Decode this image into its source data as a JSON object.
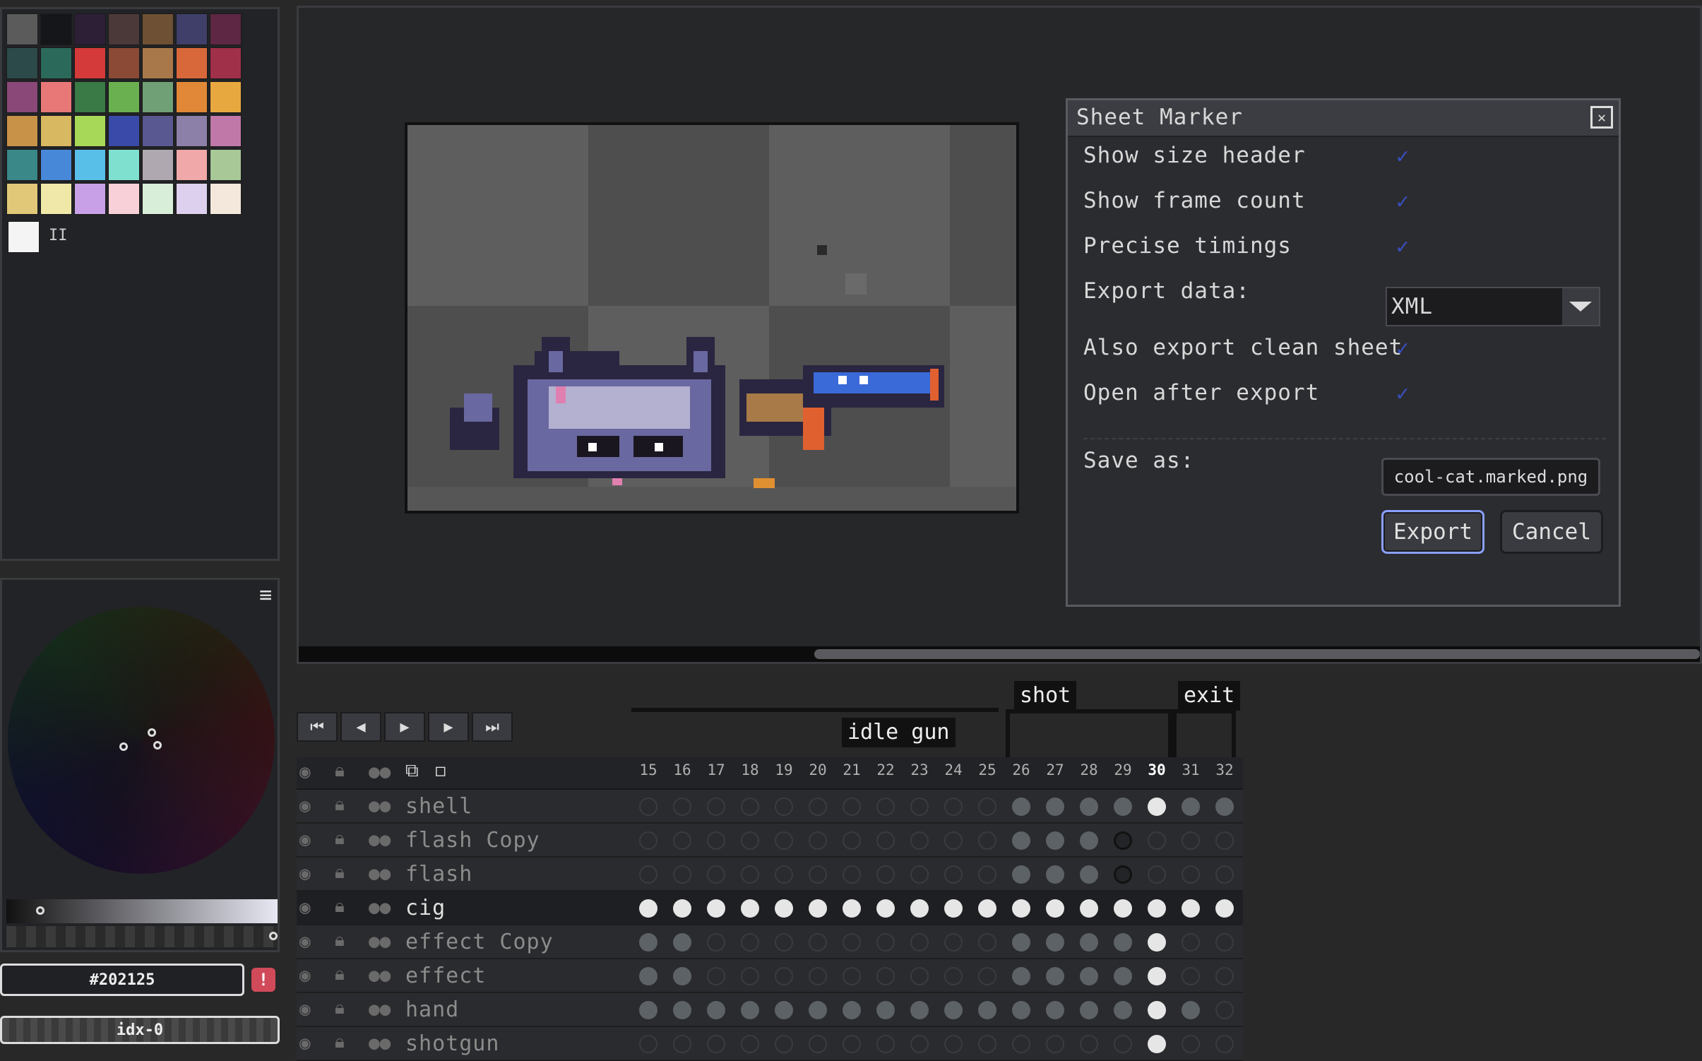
{
  "palette": {
    "colors": [
      "#5b5b5b",
      "#14161a",
      "#2c1f36",
      "#4b3838",
      "#6e5134",
      "#3f3f6a",
      "#5e2744",
      "#2d4a4a",
      "#2b6a5a",
      "#d43a3a",
      "#8a4a36",
      "#a8784a",
      "#d8683a",
      "#a0304a",
      "#8a4878",
      "#e87878",
      "#3a7a46",
      "#6ab050",
      "#70a076",
      "#e08838",
      "#e8a840",
      "#c89248",
      "#d8b860",
      "#a8d858",
      "#3a4aa8",
      "#5a5890",
      "#8c80a8",
      "#c078a8",
      "#3a8888",
      "#4888d8",
      "#58c0e8",
      "#80e0d0",
      "#b0a8b0",
      "#f0a8a8",
      "#a8c898",
      "#e0c878",
      "#f0e8a8",
      "#c8a0e8",
      "#f8d0d8",
      "#d8eed8",
      "#dcd0ee",
      "#f4e8dc"
    ],
    "extra_white": "#f4f4f4",
    "pause_glyph": "II"
  },
  "color_panel": {
    "menu_glyph": "≡",
    "hex_value": "#202125",
    "warn_glyph": "!",
    "index_label": "idx-0"
  },
  "dialog": {
    "title": "Sheet Marker",
    "close_glyph": "✕",
    "options": [
      {
        "label": "Show size header",
        "checked": true
      },
      {
        "label": "Show frame count",
        "checked": true
      },
      {
        "label": "Precise timings",
        "checked": true
      }
    ],
    "export_data_label": "Export data:",
    "export_data_value": "XML",
    "options2": [
      {
        "label": "Also export clean sheet",
        "checked": true
      },
      {
        "label": "Open after export",
        "checked": true
      }
    ],
    "save_as_label": "Save as:",
    "save_as_value": "cool-cat.marked.png",
    "export_button": "Export",
    "cancel_button": "Cancel",
    "check_glyph": "✓"
  },
  "timeline": {
    "controls": [
      "⏮",
      "◀",
      "▶",
      "▶",
      "⏭"
    ],
    "tags": [
      {
        "label": "idle gun"
      },
      {
        "label": "shot"
      },
      {
        "label": "exit"
      }
    ],
    "frames": [
      "15",
      "16",
      "17",
      "18",
      "19",
      "20",
      "21",
      "22",
      "23",
      "24",
      "25",
      "26",
      "27",
      "28",
      "29",
      "30",
      "31",
      "32"
    ],
    "current_frame": "30",
    "layers": [
      {
        "name": "shell",
        "cells": "eeeeeeeeeeeggggwgg"
      },
      {
        "name": "flash Copy",
        "cells": "eeeeeeeeeeeggg reee"
      },
      {
        "name": "flash",
        "cells": "eeeeeeeeeeeggg reee"
      },
      {
        "name": "cig",
        "cells": "wwwwwwwwwwwwwwwwww"
      },
      {
        "name": "effect Copy",
        "cells": "ggeeeeeeeeegggg wee"
      },
      {
        "name": "effect",
        "cells": "ggeeeeeeeeegggg wee"
      },
      {
        "name": "hand",
        "cells": "gggggggggggggggwge"
      },
      {
        "name": "shotgun",
        "cells": "eeeeeeeeeeeeeeewee"
      }
    ]
  }
}
